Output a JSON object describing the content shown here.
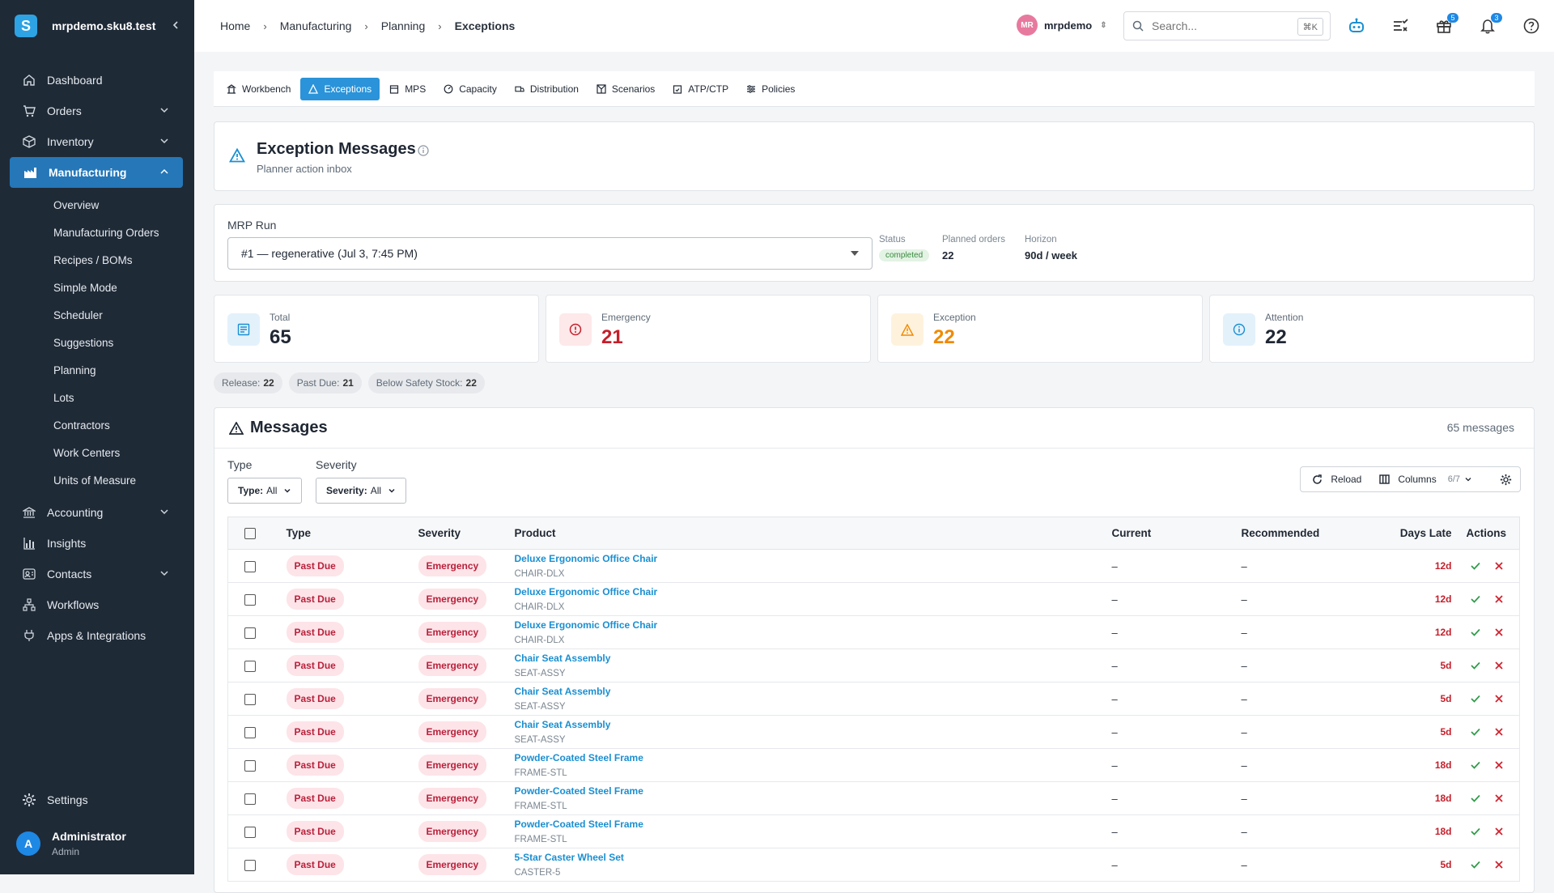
{
  "brand": {
    "name": "mrpdemo.sku8.test",
    "logo_letter": "S"
  },
  "sidebar": {
    "items": [
      {
        "label": "Dashboard",
        "icon": "home-icon"
      },
      {
        "label": "Orders",
        "icon": "cart-icon"
      },
      {
        "label": "Inventory",
        "icon": "box-icon"
      },
      {
        "label": "Manufacturing",
        "icon": "factory-icon"
      },
      {
        "label": "Accounting",
        "icon": "bank-icon"
      },
      {
        "label": "Insights",
        "icon": "bar-chart-icon"
      },
      {
        "label": "Contacts",
        "icon": "contacts-icon"
      },
      {
        "label": "Workflows",
        "icon": "workflow-icon"
      },
      {
        "label": "Apps & Integrations",
        "icon": "plug-icon"
      }
    ],
    "manufacturing_sub": [
      "Overview",
      "Manufacturing Orders",
      "Recipes / BOMs",
      "Simple Mode",
      "Scheduler",
      "Suggestions",
      "Planning",
      "Lots",
      "Contractors",
      "Work Centers",
      "Units of Measure"
    ],
    "settings": "Settings",
    "user": {
      "initial": "A",
      "name": "Administrator",
      "role": "Admin"
    }
  },
  "header": {
    "breadcrumbs": [
      "Home",
      "Manufacturing",
      "Planning",
      "Exceptions"
    ],
    "org": {
      "initials": "MR",
      "name": "mrpdemo"
    },
    "search": {
      "placeholder": "Search...",
      "shortcut": "⌘K"
    },
    "badges": {
      "gifts": "5",
      "notifications": "3"
    }
  },
  "tabs": [
    "Workbench",
    "Exceptions",
    "MPS",
    "Capacity",
    "Distribution",
    "Scenarios",
    "ATP/CTP",
    "Policies"
  ],
  "page": {
    "title": "Exception Messages",
    "subtitle": "Planner action inbox"
  },
  "run": {
    "label": "MRP Run",
    "selected": "#1 — regenerative (Jul 3, 7:45 PM)",
    "status_label": "Status",
    "status": "completed",
    "planned_label": "Planned orders",
    "planned": "22",
    "horizon_label": "Horizon",
    "horizon": "90d / week"
  },
  "kpis": [
    {
      "label": "Total",
      "value": "65",
      "color": "#1f2733",
      "bg": "#e3f1fb",
      "icon": "list-icon"
    },
    {
      "label": "Emergency",
      "value": "21",
      "color": "#c41f2b",
      "bg": "#fde8ea",
      "icon": "alert-circle-icon"
    },
    {
      "label": "Exception",
      "value": "22",
      "color": "#f08a00",
      "bg": "#fff2dd",
      "icon": "warning-icon"
    },
    {
      "label": "Attention",
      "value": "22",
      "color": "#1f2733",
      "bg": "#e3f1fb",
      "icon": "info-icon"
    }
  ],
  "chips": [
    {
      "label": "Release:",
      "value": "22"
    },
    {
      "label": "Past Due:",
      "value": "21"
    },
    {
      "label": "Below Safety Stock:",
      "value": "22"
    }
  ],
  "messages": {
    "title": "Messages",
    "count": "65 messages",
    "filter_type_label": "Type",
    "filter_type_key": "Type:",
    "filter_type_val": "All",
    "filter_sev_label": "Severity",
    "filter_sev_key": "Severity:",
    "filter_sev_val": "All",
    "reload": "Reload",
    "columns": "Columns",
    "columns_count": "6/7",
    "columns_headers": [
      "Type",
      "Severity",
      "Product",
      "Current",
      "Recommended",
      "Days Late",
      "Actions"
    ],
    "rows": [
      {
        "type": "Past Due",
        "severity": "Emergency",
        "product": "Deluxe Ergonomic Office Chair",
        "sku": "CHAIR-DLX",
        "current": "–",
        "recommended": "–",
        "late": "12d"
      },
      {
        "type": "Past Due",
        "severity": "Emergency",
        "product": "Deluxe Ergonomic Office Chair",
        "sku": "CHAIR-DLX",
        "current": "–",
        "recommended": "–",
        "late": "12d"
      },
      {
        "type": "Past Due",
        "severity": "Emergency",
        "product": "Deluxe Ergonomic Office Chair",
        "sku": "CHAIR-DLX",
        "current": "–",
        "recommended": "–",
        "late": "12d"
      },
      {
        "type": "Past Due",
        "severity": "Emergency",
        "product": "Chair Seat Assembly",
        "sku": "SEAT-ASSY",
        "current": "–",
        "recommended": "–",
        "late": "5d"
      },
      {
        "type": "Past Due",
        "severity": "Emergency",
        "product": "Chair Seat Assembly",
        "sku": "SEAT-ASSY",
        "current": "–",
        "recommended": "–",
        "late": "5d"
      },
      {
        "type": "Past Due",
        "severity": "Emergency",
        "product": "Chair Seat Assembly",
        "sku": "SEAT-ASSY",
        "current": "–",
        "recommended": "–",
        "late": "5d"
      },
      {
        "type": "Past Due",
        "severity": "Emergency",
        "product": "Powder-Coated Steel Frame",
        "sku": "FRAME-STL",
        "current": "–",
        "recommended": "–",
        "late": "18d"
      },
      {
        "type": "Past Due",
        "severity": "Emergency",
        "product": "Powder-Coated Steel Frame",
        "sku": "FRAME-STL",
        "current": "–",
        "recommended": "–",
        "late": "18d"
      },
      {
        "type": "Past Due",
        "severity": "Emergency",
        "product": "Powder-Coated Steel Frame",
        "sku": "FRAME-STL",
        "current": "–",
        "recommended": "–",
        "late": "18d"
      },
      {
        "type": "Past Due",
        "severity": "Emergency",
        "product": "5-Star Caster Wheel Set",
        "sku": "CASTER-5",
        "current": "–",
        "recommended": "–",
        "late": "5d"
      }
    ]
  }
}
